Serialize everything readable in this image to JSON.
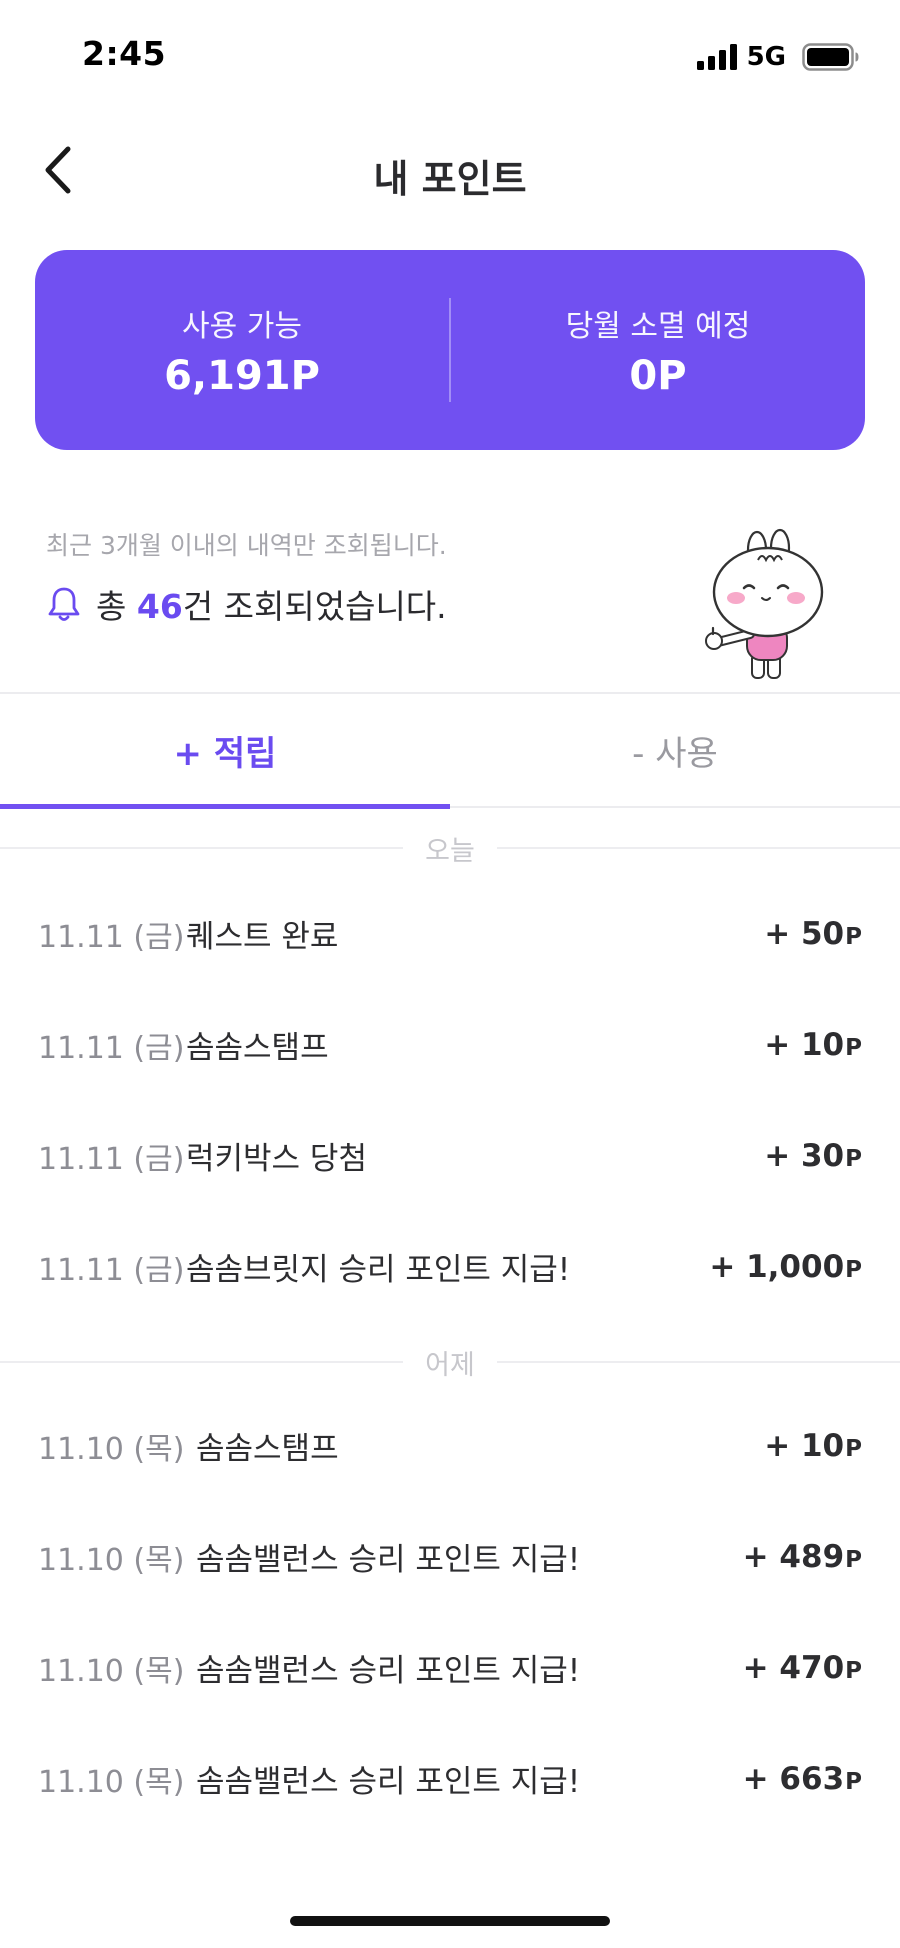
{
  "status_bar": {
    "time": "2:45",
    "network": "5G"
  },
  "header": {
    "title": "내 포인트"
  },
  "points_card": {
    "available_label": "사용 가능",
    "available_value": "6,191P",
    "expiring_label": "당월 소멸 예정",
    "expiring_value": "0P",
    "background_color": "#7150f1"
  },
  "notice": {
    "subtext": "최근 3개월 이내의 내역만 조회됩니다.",
    "prefix": "총 ",
    "count": "46",
    "suffix": "건 조회되었습니다."
  },
  "tabs": [
    {
      "label": "+ 적립",
      "active": true
    },
    {
      "label": "- 사용",
      "active": false
    }
  ],
  "sections": [
    {
      "label": "오늘",
      "rows": [
        {
          "date": "11.11 (금)",
          "desc": "퀘스트 완료",
          "amount": "+ 50",
          "unit": "P"
        },
        {
          "date": "11.11 (금)",
          "desc": "솜솜스탬프",
          "amount": "+ 10",
          "unit": "P"
        },
        {
          "date": "11.11 (금)",
          "desc": "럭키박스 당첨",
          "amount": "+ 30",
          "unit": "P"
        },
        {
          "date": "11.11 (금)",
          "desc": "솜솜브릿지 승리 포인트 지급!",
          "amount": "+ 1,000",
          "unit": "P"
        }
      ]
    },
    {
      "label": "어제",
      "rows": [
        {
          "date": "11.10 (목)",
          "desc": "솜솜스탬프",
          "amount": "+ 10",
          "unit": "P"
        },
        {
          "date": "11.10 (목)",
          "desc": "솜솜밸런스 승리 포인트 지급!",
          "amount": "+ 489",
          "unit": "P"
        },
        {
          "date": "11.10 (목)",
          "desc": "솜솜밸런스 승리 포인트 지급!",
          "amount": "+ 470",
          "unit": "P"
        },
        {
          "date": "11.10 (목)",
          "desc": "솜솜밸런스 승리 포인트 지급!",
          "amount": "+ 663",
          "unit": "P"
        }
      ]
    }
  ],
  "icons": {
    "back": "chevron-left-icon",
    "bell": "bell-icon",
    "signal": "signal-icon",
    "battery": "battery-icon",
    "mascot": "rabbit-mascot"
  },
  "colors": {
    "accent": "#7150f1",
    "accent_text": "#6a4bf0"
  }
}
